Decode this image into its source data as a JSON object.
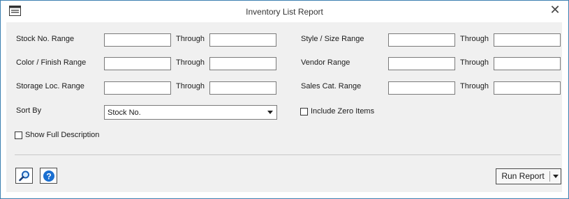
{
  "window": {
    "title": "Inventory List Report"
  },
  "icons": {
    "app": "report-window-icon",
    "close": "close-icon",
    "search": "magnifier-icon",
    "help": "help-icon",
    "dropdown": "chevron-down-icon"
  },
  "colors": {
    "window_border": "#3c7fb1",
    "panel_background": "#f0f0f0",
    "help_blue": "#1a6fd1"
  },
  "filters": {
    "stock_no": {
      "label": "Stock No. Range",
      "from": "",
      "to": "",
      "through_label": "Through"
    },
    "color_finish": {
      "label": "Color / Finish Range",
      "from": "",
      "to": "",
      "through_label": "Through"
    },
    "storage_loc": {
      "label": "Storage Loc. Range",
      "from": "",
      "to": "",
      "through_label": "Through"
    },
    "style_size": {
      "label": "Style / Size Range",
      "from": "",
      "to": "",
      "through_label": "Through"
    },
    "vendor": {
      "label": "Vendor Range",
      "from": "",
      "to": "",
      "through_label": "Through"
    },
    "sales_cat": {
      "label": "Sales Cat. Range",
      "from": "",
      "to": "",
      "through_label": "Through"
    }
  },
  "sort_by": {
    "label": "Sort By",
    "selected": "Stock No."
  },
  "options": {
    "include_zero_items": {
      "label": "Include Zero Items",
      "checked": false
    },
    "show_full_description": {
      "label": "Show Full Description",
      "checked": false
    }
  },
  "footer": {
    "run_report_label": "Run Report"
  }
}
